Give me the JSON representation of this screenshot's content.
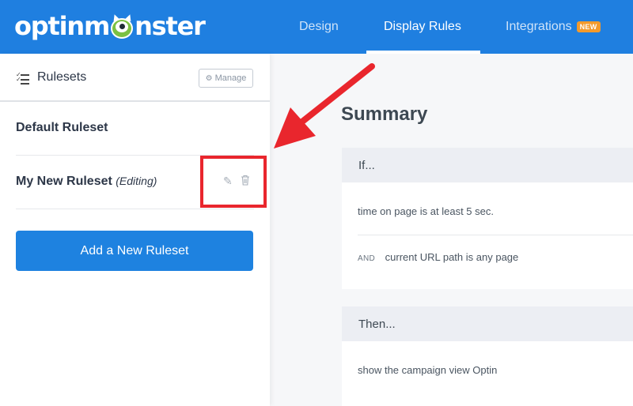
{
  "header": {
    "logo": "optinmonster",
    "logo_parts": {
      "prefix": "optinm",
      "suffix": "nster"
    },
    "tabs": [
      {
        "label": "Design",
        "active": false
      },
      {
        "label": "Display Rules",
        "active": true
      },
      {
        "label": "Integrations",
        "active": false,
        "badge": "NEW"
      }
    ]
  },
  "sidebar": {
    "title": "Rulesets",
    "manage_label": "Manage",
    "rulesets": [
      {
        "name": "Default Ruleset",
        "status": ""
      },
      {
        "name": "My New Ruleset",
        "status": "(Editing)"
      }
    ],
    "add_button_label": "Add a New Ruleset"
  },
  "summary": {
    "title": "Summary",
    "if_label": "If...",
    "conditions": [
      {
        "prefix": "",
        "text": "time on page is at least 5 sec."
      },
      {
        "prefix": "AND",
        "text": "current URL path is any page"
      }
    ],
    "then_label": "Then...",
    "action": "show the campaign view Optin"
  },
  "colors": {
    "brand_blue": "#1f7fe0",
    "button_blue": "#1e82e0",
    "badge_orange": "#f39a2c",
    "highlight_red": "#e9262d",
    "monster_green": "#7bc143"
  },
  "icons": {
    "list": "list-check-icon",
    "gear": "gear-icon",
    "edit": "pencil-icon",
    "delete": "trash-icon",
    "annotation": "red-arrow"
  }
}
